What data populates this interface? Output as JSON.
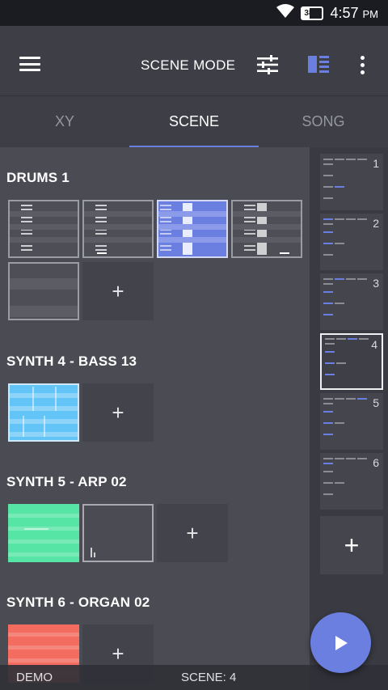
{
  "status_bar": {
    "battery": "38%",
    "time": "4:57",
    "ampm": "PM",
    "icons": [
      "wifi-icon",
      "battery-icon"
    ]
  },
  "app_bar": {
    "title": "SCENE MODE",
    "icons": [
      "menu-icon",
      "mixer-sliders-icon",
      "layout-icon",
      "more-vert-icon"
    ],
    "accent": "#6b7fe0"
  },
  "tabs": [
    {
      "label": "XY",
      "active": false
    },
    {
      "label": "SCENE",
      "active": true
    },
    {
      "label": "SONG",
      "active": false
    }
  ],
  "tracks": [
    {
      "name": "DRUMS 1"
    },
    {
      "name": "SYNTH 4 - BASS 13"
    },
    {
      "name": "SYNTH 5 - ARP 02"
    },
    {
      "name": "SYNTH 6 - ORGAN 02"
    }
  ],
  "add_label": "+",
  "scenes": [
    "1",
    "2",
    "3",
    "4",
    "5",
    "6"
  ],
  "active_scene": "4",
  "scene_add_label": "+",
  "bottom_bar": {
    "left": "DEMO",
    "right": "SCENE: 4"
  },
  "play_button_icon": "play-icon"
}
